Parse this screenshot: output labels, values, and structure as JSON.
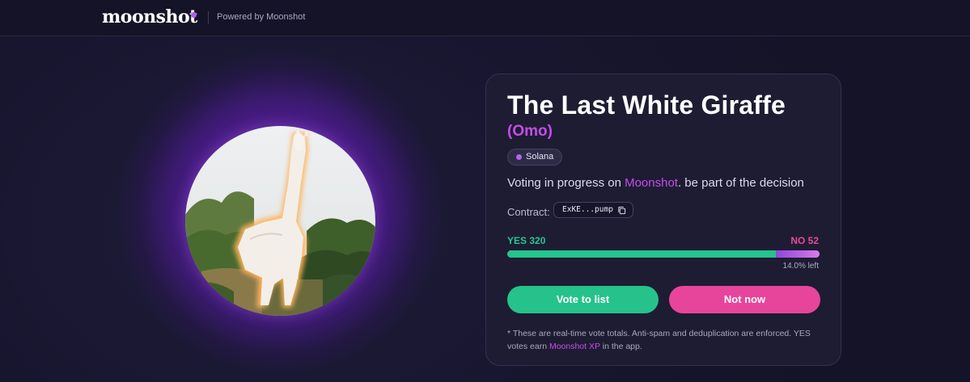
{
  "header": {
    "logo_text": "moonshot",
    "powered_by": "Powered by Moonshot",
    "accent_color": "#b45cf0"
  },
  "token": {
    "name": "The Last White Giraffe",
    "ticker": "(Omo)",
    "chain": "Solana",
    "image_icon": "white-giraffe-avatar"
  },
  "status": {
    "prefix": "Voting in progress on ",
    "brand": "Moonshot",
    "suffix": ". be part of the decision"
  },
  "contract": {
    "label": "Contract:",
    "value": "ExKE...pump",
    "copy_icon": "copy-icon"
  },
  "vote": {
    "yes_label": "YES 320",
    "no_label": "NO 52",
    "yes_count": 320,
    "no_count": 52,
    "yes_fraction": 0.86,
    "no_fraction": 0.14,
    "remaining_text": "14.0% left",
    "yes_color": "#24c48e",
    "no_color": "#e64b9b"
  },
  "buttons": {
    "vote_label": "Vote to list",
    "not_now_label": "Not now"
  },
  "footnote": {
    "text": "* These are real-time vote totals. Anti-spam and deduplication are enforced. YES votes earn ",
    "xp_link": "Moonshot XP",
    "suffix": " in the app."
  }
}
